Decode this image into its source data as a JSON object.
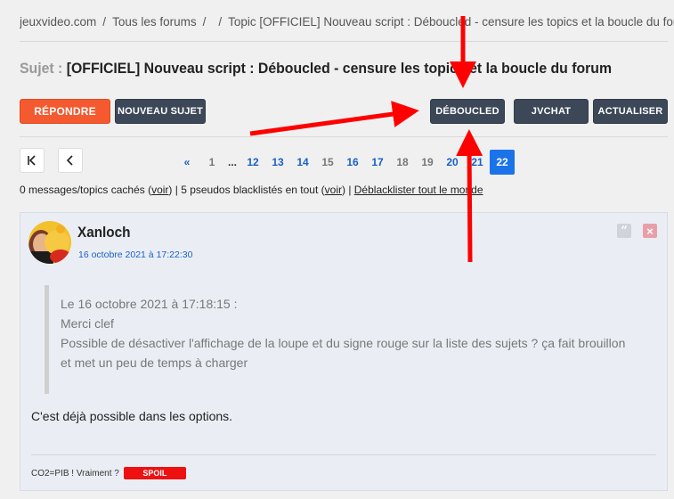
{
  "breadcrumb": {
    "site": "jeuxvideo.com",
    "forums": "Tous les forums",
    "sep": "/",
    "topic": "Topic [OFFICIEL] Nouveau script : Déboucled - censure les topics et la boucle du forum"
  },
  "subject": {
    "label": "Sujet :",
    "title": "[OFFICIEL] Nouveau script : Déboucled - censure les topics et la boucle du forum"
  },
  "toolbar": {
    "reply": "Répondre",
    "new_topic": "Nouveau sujet",
    "deboucled": "Déboucled",
    "jvchat": "JVChat",
    "refresh": "Actualiser"
  },
  "pagination": {
    "first_icon": "first-page-icon",
    "prev_icon": "previous-page-icon",
    "prev_symbol": "«",
    "p1": "1",
    "dots": "...",
    "p12": "12",
    "p13": "13",
    "p14": "14",
    "p15": "15",
    "p16": "16",
    "p17": "17",
    "p18": "18",
    "p19": "19",
    "p20": "20",
    "p21": "21",
    "current": "22"
  },
  "info": {
    "t1": "0 messages/topics cachés (",
    "voir": "voir",
    "t2": ") | 5 pseudos blacklistés en tout (",
    "t3": ") | ",
    "deblacklist": "Déblacklister tout le monde"
  },
  "post": {
    "author": "Xanloch",
    "date": "16 octobre 2021 à 17:22:30",
    "quote_header": "Le 16 octobre 2021 à 17:18:15 :",
    "quote_line1": "Merci clef",
    "quote_line2": "Possible de désactiver l'affichage de la loupe et du signe rouge sur la liste des sujets ? ça fait brouillon",
    "quote_line3": "et met un peu de temps à charger",
    "body": "C'est déjà possible dans les options.",
    "signature": "CO2=PIB ! Vraiment ?",
    "spoil": "SPOIL"
  },
  "colors": {
    "accent_orange": "#f4592f",
    "button_dark": "#3c4758",
    "link_blue": "#1a5fc7",
    "annotation_red": "#ff0000"
  }
}
